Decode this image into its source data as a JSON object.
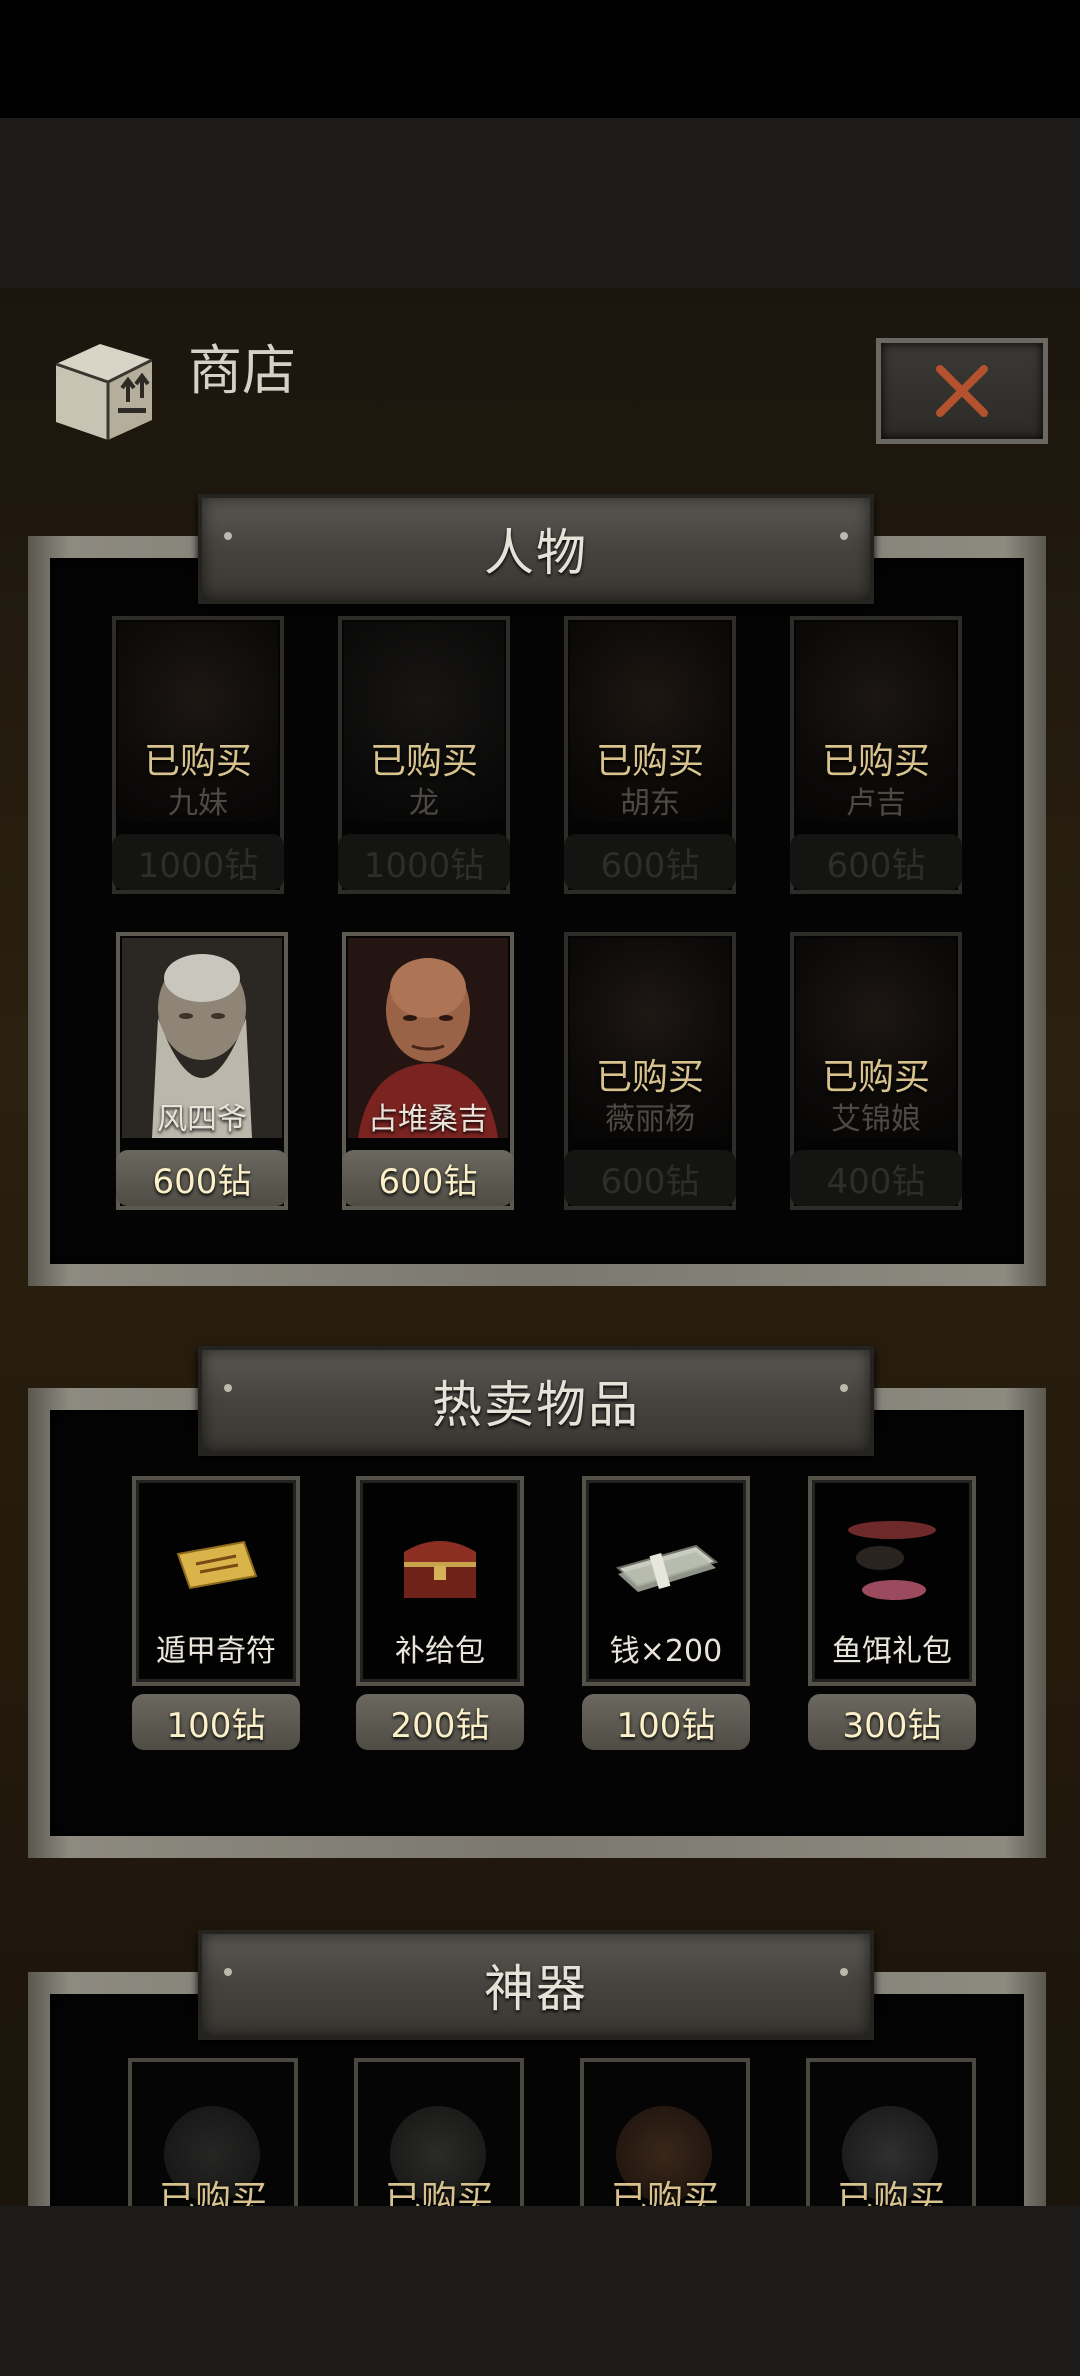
{
  "header": {
    "title": "商店"
  },
  "sections": {
    "characters": {
      "title": "人物",
      "items": [
        {
          "name": "九妹",
          "price": "1000钻",
          "status": "已购买"
        },
        {
          "name": "龙",
          "price": "1000钻",
          "status": "已购买"
        },
        {
          "name": "胡东",
          "price": "600钻",
          "status": "已购买"
        },
        {
          "name": "卢吉",
          "price": "600钻",
          "status": "已购买"
        },
        {
          "name": "风四爷",
          "price": "600钻",
          "status": ""
        },
        {
          "name": "占堆桑吉",
          "price": "600钻",
          "status": ""
        },
        {
          "name": "薇丽杨",
          "price": "600钻",
          "status": "已购买"
        },
        {
          "name": "艾锦娘",
          "price": "400钻",
          "status": "已购买"
        }
      ]
    },
    "hot_items": {
      "title": "热卖物品",
      "items": [
        {
          "name": "遁甲奇符",
          "price": "100钻",
          "icon": "talisman-icon"
        },
        {
          "name": "补给包",
          "price": "200钻",
          "icon": "chest-icon"
        },
        {
          "name": "钱×200",
          "price": "100钻",
          "icon": "money-icon"
        },
        {
          "name": "鱼饵礼包",
          "price": "300钻",
          "icon": "fishing-lure-icon"
        }
      ]
    },
    "artifacts": {
      "title": "神器",
      "items": [
        {
          "status": "已购买",
          "icon": "bronze-mirror-icon"
        },
        {
          "status": "已购买",
          "icon": "bronze-mirror-icon"
        },
        {
          "status": "已购买",
          "icon": "bronze-mirror-icon"
        },
        {
          "status": "已购买",
          "icon": "bronze-mirror-icon"
        }
      ]
    }
  },
  "colors": {
    "accent_close": "#b4512e",
    "gold_text": "#d8c38e",
    "price_text": "#fbf0c8"
  }
}
